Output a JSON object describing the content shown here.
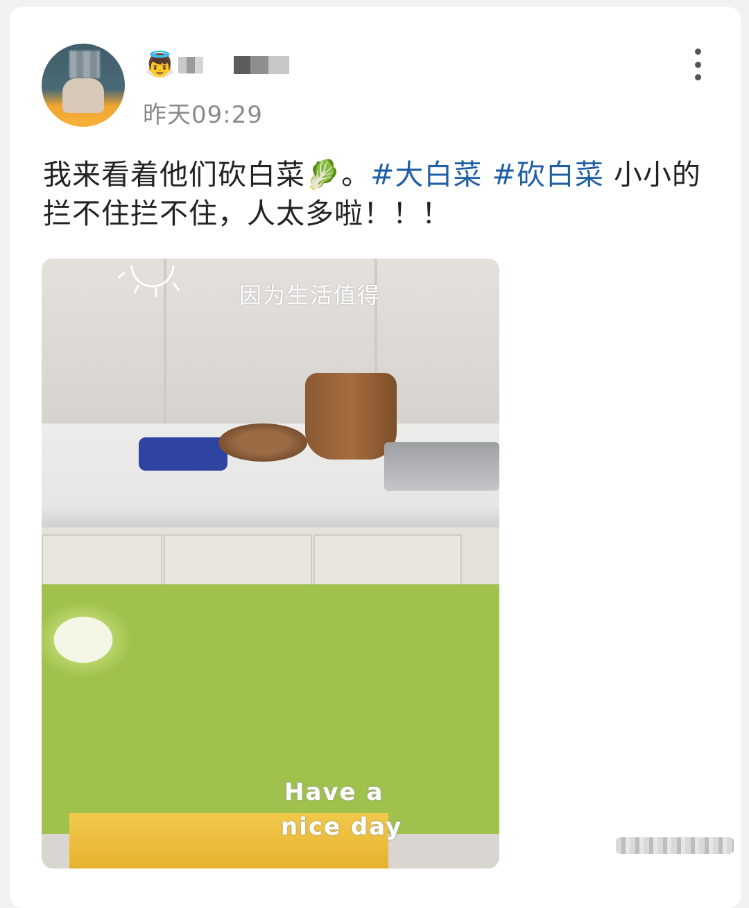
{
  "post": {
    "time": "昨天09:29",
    "text_before": "我来看着他们砍白菜",
    "emoji": "🥬",
    "text_period": "。",
    "tags": [
      "#大白菜",
      "#砍白菜"
    ],
    "text_after": " 小小的拦不住拦不住，人太多啦！！！"
  },
  "photo": {
    "handwriting": "因为生活值得",
    "overlay_line1": "Have a",
    "overlay_line2": "nice day"
  },
  "icons": {
    "author_badge": "angel-emoji-icon",
    "menu": "more-vertical-icon"
  },
  "colors": {
    "tag": "#1f5fa6",
    "time": "#8a8a8a",
    "background": "#f2f2f2",
    "card": "#ffffff"
  }
}
